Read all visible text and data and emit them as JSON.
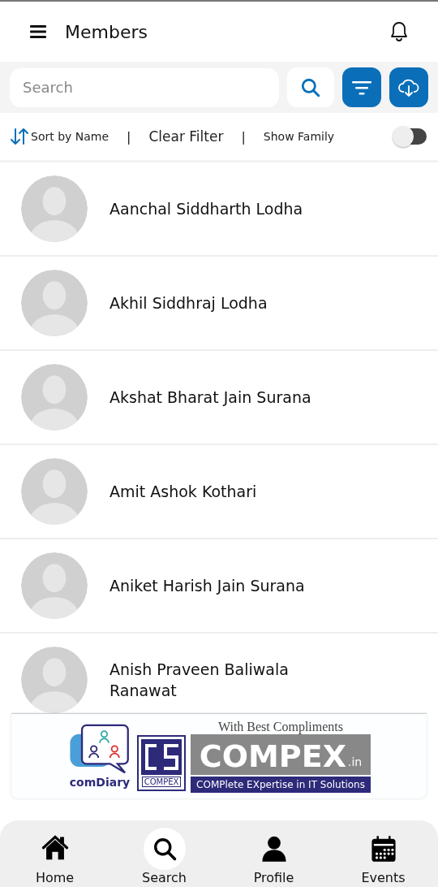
{
  "app_bar": {
    "title": "Members"
  },
  "search": {
    "placeholder": "Search"
  },
  "filter_bar": {
    "sort_label": "Sort by Name",
    "separator_1": "|",
    "clear_filter": "Clear Filter",
    "separator_2": "|",
    "show_family": {
      "label": "Show Family",
      "on": false
    }
  },
  "members": [
    {
      "name": "Aanchal Siddharth Lodha"
    },
    {
      "name": "Akhil Siddhraj Lodha"
    },
    {
      "name": "Akshat Bharat Jain Surana"
    },
    {
      "name": "Amit Ashok Kothari"
    },
    {
      "name": "Aniket Harish Jain Surana"
    },
    {
      "name": "Anish Praveen Baliwala Ranawat"
    }
  ],
  "banner": {
    "tagline": "With Best Compliments",
    "app_name": "comDiary",
    "company_small": "COMPEX",
    "company": "COMPEX",
    "domain": ".in",
    "slogan": "COMPlete EXpertise in IT Solutions"
  },
  "bottom_nav": [
    {
      "label": "Home",
      "selected": false
    },
    {
      "label": "Search",
      "selected": true
    },
    {
      "label": "Profile",
      "selected": false
    },
    {
      "label": "Events",
      "selected": false
    }
  ]
}
